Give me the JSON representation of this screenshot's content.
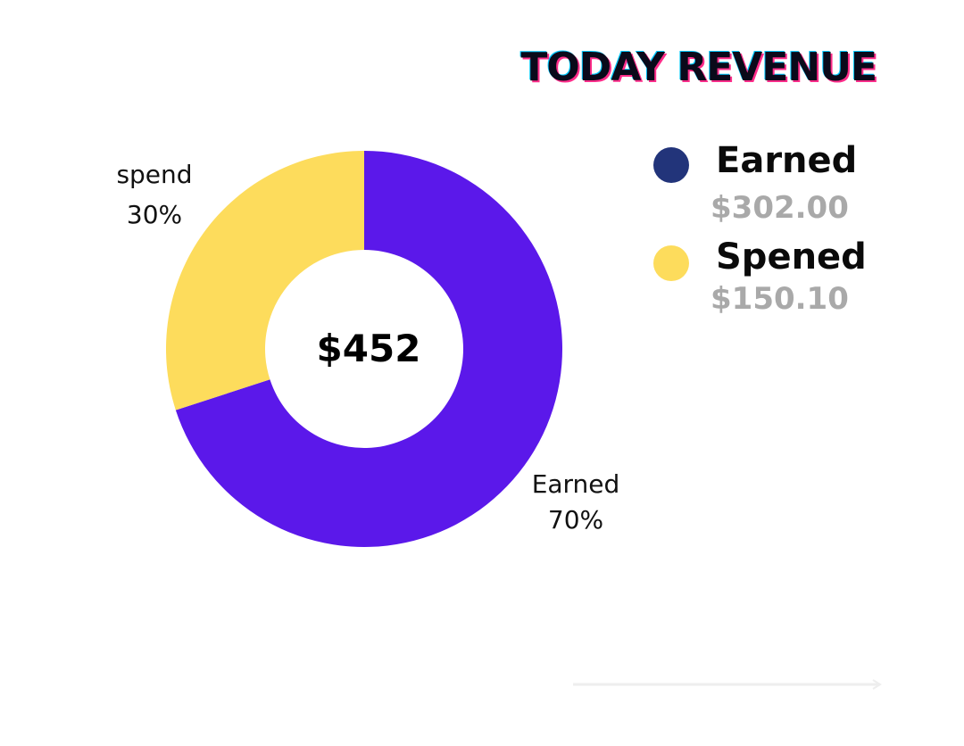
{
  "chart_data": {
    "type": "pie",
    "title": "TODAY REVENUE",
    "center_label": "$452",
    "slices": [
      {
        "name": "Earned",
        "label": "Earned",
        "value": 70,
        "value_label": "70%",
        "color": "#5b18ea"
      },
      {
        "name": "Spend",
        "label": "spend",
        "value": 30,
        "value_label": "30%",
        "color": "#fddc5c"
      }
    ],
    "donut": true
  },
  "legend": {
    "items": [
      {
        "name": "Earned",
        "amount": "$302.00",
        "color": "#22347a"
      },
      {
        "name": "Spened",
        "amount": "$150.10",
        "color": "#fddc5c"
      }
    ]
  },
  "colors": {
    "earned_slice": "#5b18ea",
    "spend_slice": "#fddc5c",
    "earned_legend": "#22347a",
    "amount_text": "#a9a9a9"
  }
}
